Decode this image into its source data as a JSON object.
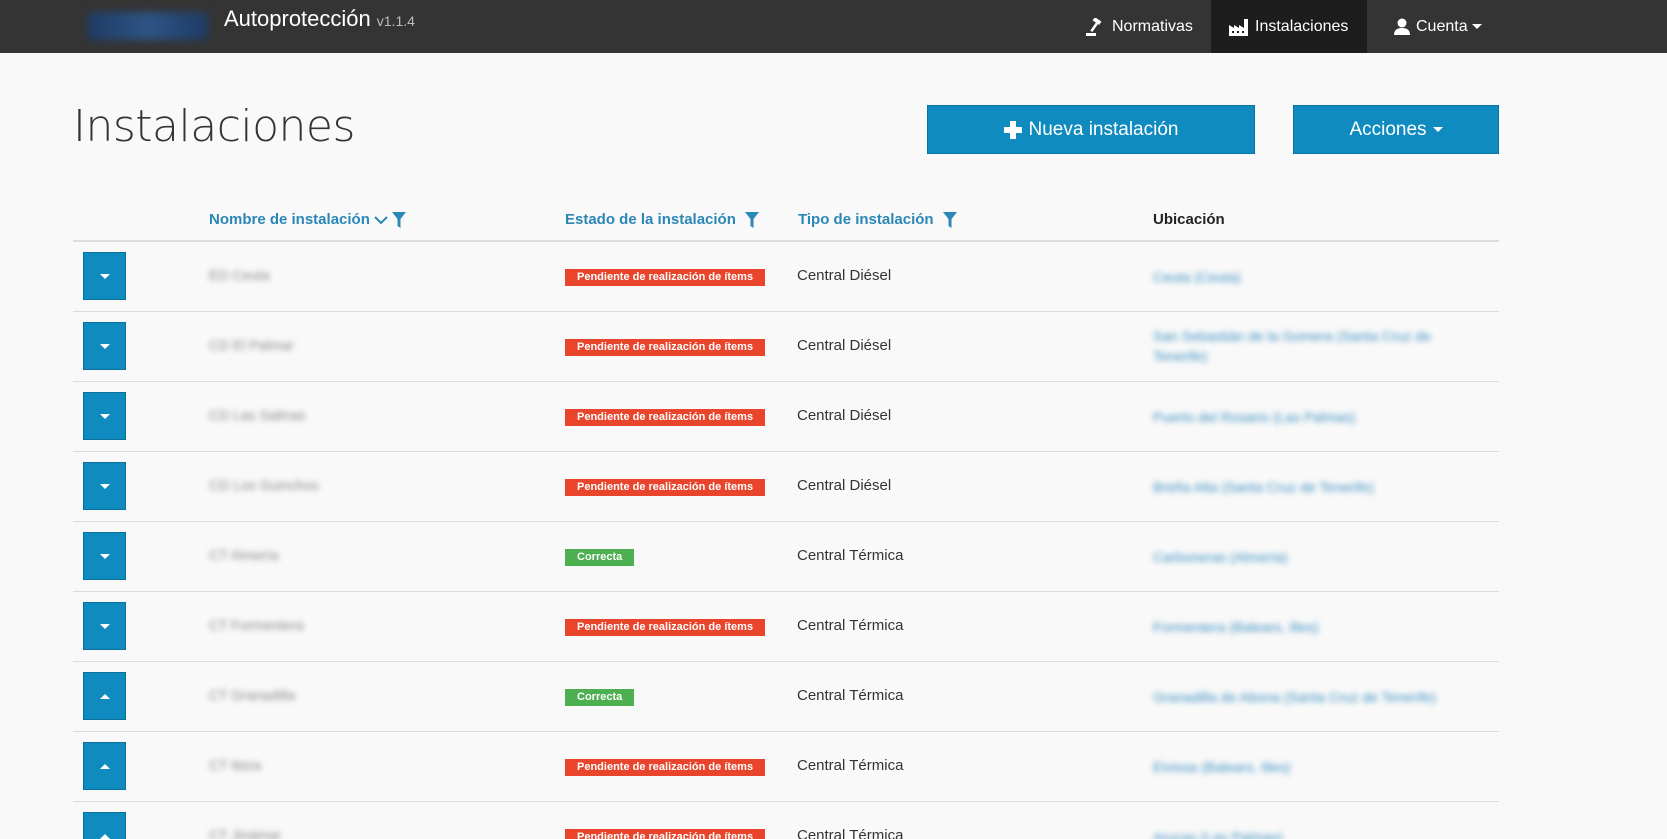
{
  "app": {
    "title": "Autoprotección",
    "version": "v1.1.4"
  },
  "nav": {
    "normativas": "Normativas",
    "instalaciones": "Instalaciones",
    "cuenta": "Cuenta"
  },
  "page": {
    "title": "Instalaciones",
    "new_button": "Nueva instalación",
    "actions_button": "Acciones"
  },
  "table": {
    "columns": {
      "name": "Nombre de instalación",
      "status": "Estado de la instalación",
      "type": "Tipo de instalación",
      "location": "Ubicación"
    },
    "rows": [
      {
        "name": "ED Ceuta",
        "status": "Pendiente de realización de ítems",
        "status_color": "#e8452c",
        "type": "Central Diésel",
        "location": "Ceuta (Ceuta)",
        "expanded": false
      },
      {
        "name": "CD El Palmar",
        "status": "Pendiente de realización de ítems",
        "status_color": "#e8452c",
        "type": "Central Diésel",
        "location": "San Sebastián de la Gomera (Santa Cruz de Tenerife)",
        "expanded": false
      },
      {
        "name": "CD Las Salinas",
        "status": "Pendiente de realización de ítems",
        "status_color": "#e8452c",
        "type": "Central Diésel",
        "location": "Puerto del Rosario (Las Palmas)",
        "expanded": false
      },
      {
        "name": "CD Los Guinchos",
        "status": "Pendiente de realización de ítems",
        "status_color": "#e8452c",
        "type": "Central Diésel",
        "location": "Breña Alta (Santa Cruz de Tenerife)",
        "expanded": false
      },
      {
        "name": "CT Almería",
        "status": "Correcta",
        "status_color": "#4caf50",
        "type": "Central Térmica",
        "location": "Carboneras (Almería)",
        "expanded": false
      },
      {
        "name": "CT Formentera",
        "status": "Pendiente de realización de ítems",
        "status_color": "#e8452c",
        "type": "Central Térmica",
        "location": "Formentera (Balears, Illes)",
        "expanded": false
      },
      {
        "name": "CT Granadilla",
        "status": "Correcta",
        "status_color": "#4caf50",
        "type": "Central Térmica",
        "location": "Granadilla de Abona (Santa Cruz de Tenerife)",
        "expanded": true
      },
      {
        "name": "CT Ibiza",
        "status": "Pendiente de realización de ítems",
        "status_color": "#e8452c",
        "type": "Central Térmica",
        "location": "Eivissa (Balears, Illes)",
        "expanded": true
      },
      {
        "name": "CT Jinámar",
        "status": "Pendiente de realización de ítems",
        "status_color": "#e8452c",
        "type": "Central Térmica",
        "location": "Arucas (Las Palmas)",
        "expanded": true
      }
    ]
  },
  "colors": {
    "primary": "#0f8bc0",
    "navbar": "#343434",
    "link": "#2a87b6"
  }
}
